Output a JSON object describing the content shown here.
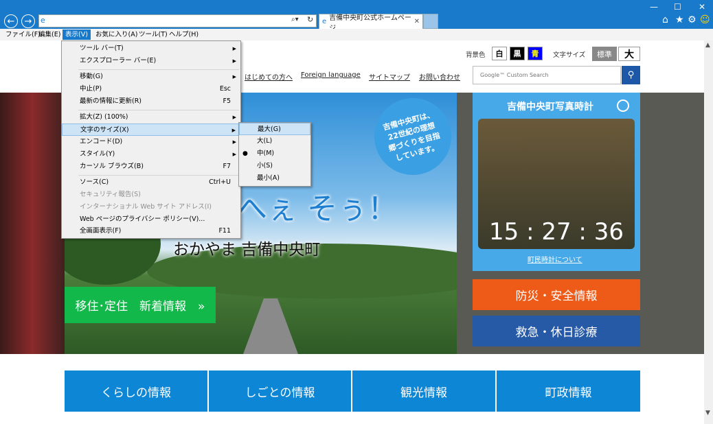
{
  "browser": {
    "tab_title": "吉備中央町公式ホームページ",
    "menu": [
      {
        "label": "ファイル(F)"
      },
      {
        "label": "編集(E)"
      },
      {
        "label": "表示(V)"
      },
      {
        "label": "お気に入り(A)"
      },
      {
        "label": "ツール(T)"
      },
      {
        "label": "ヘルプ(H)"
      }
    ]
  },
  "view_menu": {
    "items": [
      {
        "label": "ツール バー(T)",
        "shortcut": "",
        "submenu": true,
        "disabled": false
      },
      {
        "label": "エクスプローラー バー(E)",
        "shortcut": "",
        "submenu": true,
        "disabled": false
      },
      {
        "label": "移動(G)",
        "shortcut": "",
        "submenu": true,
        "disabled": false
      },
      {
        "label": "中止(P)",
        "shortcut": "Esc",
        "submenu": false,
        "disabled": false
      },
      {
        "label": "最新の情報に更新(R)",
        "shortcut": "F5",
        "submenu": false,
        "disabled": false
      },
      {
        "label": "拡大(Z) (100%)",
        "shortcut": "",
        "submenu": true,
        "disabled": false
      },
      {
        "label": "文字のサイズ(X)",
        "shortcut": "",
        "submenu": true,
        "disabled": false
      },
      {
        "label": "エンコード(D)",
        "shortcut": "",
        "submenu": true,
        "disabled": false
      },
      {
        "label": "スタイル(Y)",
        "shortcut": "",
        "submenu": true,
        "disabled": false
      },
      {
        "label": "カーソル ブラウズ(B)",
        "shortcut": "F7",
        "submenu": false,
        "disabled": false
      },
      {
        "label": "ソース(C)",
        "shortcut": "Ctrl+U",
        "submenu": false,
        "disabled": false
      },
      {
        "label": "セキュリティ報告(S)",
        "shortcut": "",
        "submenu": false,
        "disabled": true
      },
      {
        "label": "インターナショナル Web サイト アドレス(I)",
        "shortcut": "",
        "submenu": false,
        "disabled": true
      },
      {
        "label": "Web ページのプライバシー ポリシー(V)...",
        "shortcut": "",
        "submenu": false,
        "disabled": false
      },
      {
        "label": "全画面表示(F)",
        "shortcut": "F11",
        "submenu": false,
        "disabled": false
      }
    ]
  },
  "text_size_submenu": {
    "items": [
      {
        "label": "最大(G)",
        "selected": false
      },
      {
        "label": "大(L)",
        "selected": false
      },
      {
        "label": "中(M)",
        "selected": true
      },
      {
        "label": "小(S)",
        "selected": false
      },
      {
        "label": "最小(A)",
        "selected": false
      }
    ]
  },
  "site": {
    "bg_color_label": "背景色",
    "bg_options": [
      {
        "label": "白",
        "bg": "#ffffff",
        "fg": "#000000"
      },
      {
        "label": "黒",
        "bg": "#000000",
        "fg": "#ffffff"
      },
      {
        "label": "青",
        "bg": "#0000ff",
        "fg": "#ffff00"
      }
    ],
    "font_size_label": "文字サイズ",
    "font_standard": "標準",
    "font_large": "大",
    "nav": [
      "はじめての方へ",
      "Foreign language",
      "サイトマップ",
      "お問い合わせ"
    ],
    "search_placeholder": "Google™ Custom Search",
    "hero_badge": "吉備中央町は、22世紀の理想郷づくりを目指しています。",
    "hero_catch": "へぇ そぅ！",
    "hero_logo": "おかやま 吉備中央町",
    "migration_button": "移住･定住　新着情報　»",
    "photo_clock_title": "吉備中央町写真時計",
    "clock_time": "15 : 27 : 36",
    "clock_link": "町民時計について",
    "disaster_button": "防災・安全情報",
    "emergency_button": "救急・休日診療",
    "categories": [
      "くらしの情報",
      "しごとの情報",
      "観光情報",
      "町政情報"
    ]
  }
}
